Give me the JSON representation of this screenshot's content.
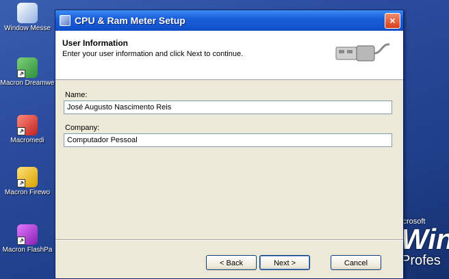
{
  "desktop": {
    "icons": [
      {
        "label": "Window Messe",
        "icon": "messenger-icon"
      },
      {
        "label": "Macron Dreamwe",
        "icon": "dreamweaver-icon"
      },
      {
        "label": "Macromedi",
        "icon": "flash-icon"
      },
      {
        "label": "Macron Firewo",
        "icon": "fireworks-icon"
      },
      {
        "label": "Macron FlashPa",
        "icon": "flashpaper-icon"
      }
    ],
    "brand": {
      "line1": "icrosoft",
      "line2": "Win",
      "line3": "Profes"
    }
  },
  "window": {
    "title": "CPU & Ram Meter Setup",
    "close_label": "×",
    "header_title": "User Information",
    "header_subtitle": "Enter your user information and click Next to continue.",
    "name_label": "Name:",
    "name_value": "José Augusto Nascimento Reis",
    "company_label": "Company:",
    "company_value": "Computador Pessoal",
    "back_label": "< Back",
    "next_label": "Next >",
    "cancel_label": "Cancel"
  }
}
